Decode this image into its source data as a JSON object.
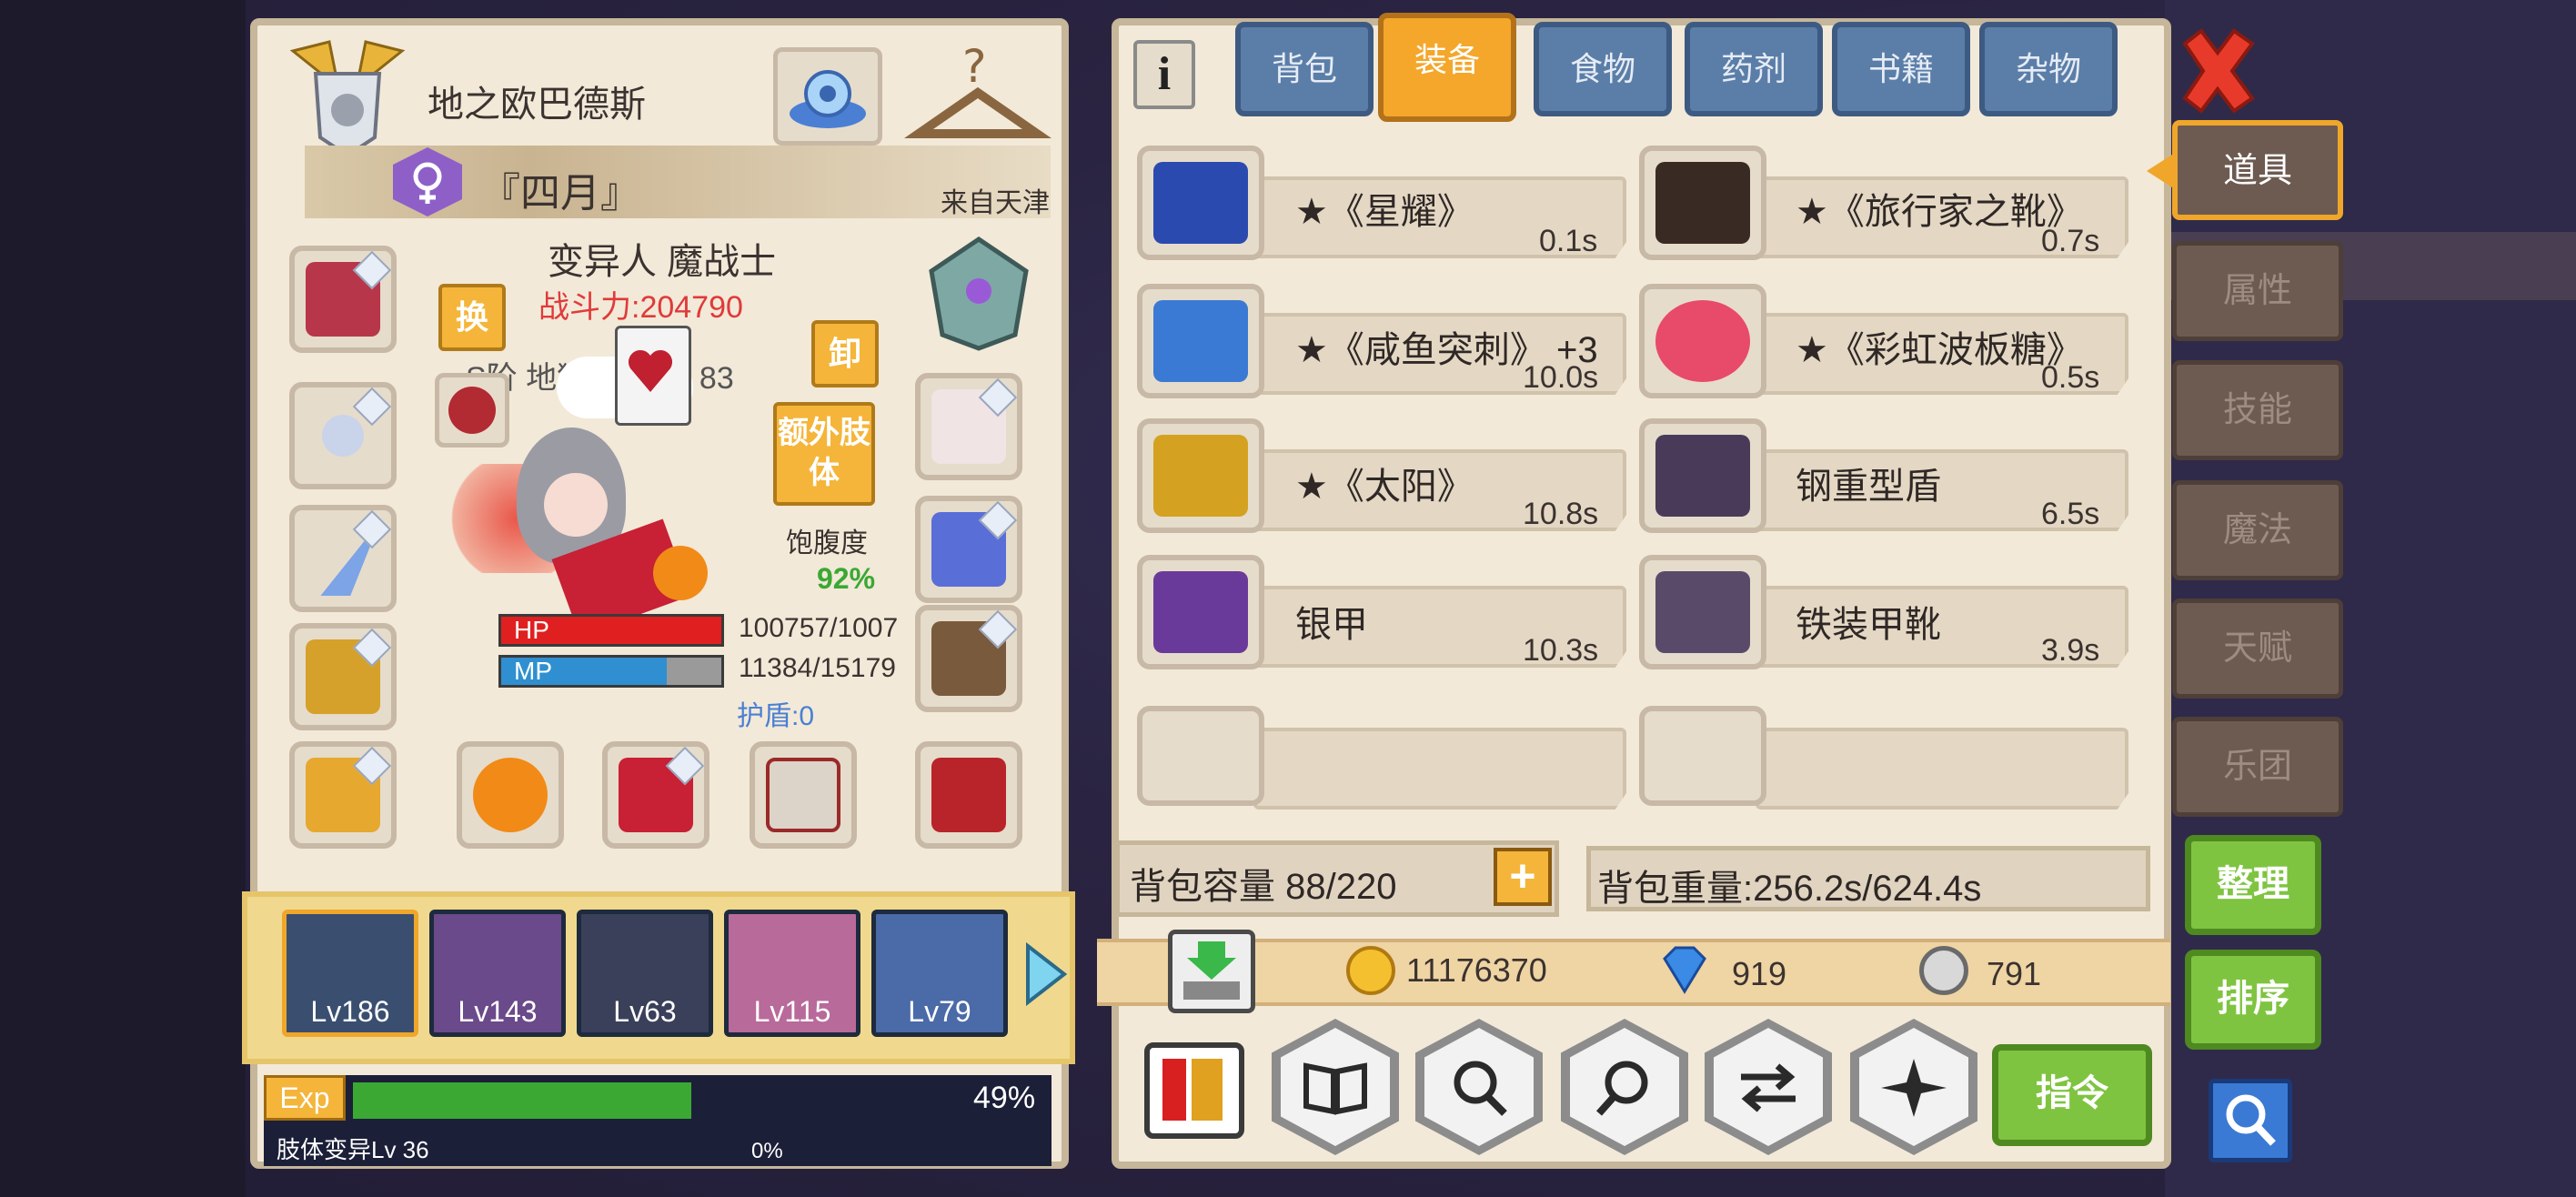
{
  "character": {
    "title": "地之欧巴德斯",
    "name": "『四月』",
    "origin": "来自天津",
    "class_line": "变异人 魔战士",
    "power": "战斗力:204790",
    "rank_line": "S阶 地狱使者 Lv 83",
    "swap_label": "换",
    "unequip_label": "卸",
    "extra_limb_label": "额外肢体",
    "satiety_label": "饱腹度",
    "satiety_value": "92%",
    "hp_label": "HP",
    "hp_value": "100757/1007",
    "hp_fraction": 1.0,
    "mp_label": "MP",
    "mp_value": "11384/15179",
    "mp_fraction": 0.75,
    "shield": "护盾:0"
  },
  "party": [
    {
      "level": "Lv186"
    },
    {
      "level": "Lv143"
    },
    {
      "level": "Lv63"
    },
    {
      "level": "Lv115"
    },
    {
      "level": "Lv79"
    }
  ],
  "exp": {
    "label": "Exp",
    "percent": "49%",
    "fraction": 0.49,
    "limb_label": "肢体变异Lv 36",
    "limb_percent": "0%"
  },
  "tabs": [
    "背包",
    "装备",
    "食物",
    "药剂",
    "书籍",
    "杂物"
  ],
  "active_tab": "装备",
  "items": [
    {
      "name": "★《星耀》",
      "weight": "0.1s"
    },
    {
      "name": "★《旅行家之靴》",
      "weight": "0.7s"
    },
    {
      "name": "★《咸鱼突刺》 +3",
      "weight": "10.0s"
    },
    {
      "name": "★《彩虹波板糖》",
      "weight": "0.5s"
    },
    {
      "name": "★《太阳》",
      "weight": "10.8s"
    },
    {
      "name": "钢重型盾",
      "weight": "6.5s"
    },
    {
      "name": "银甲",
      "weight": "10.3s"
    },
    {
      "name": "铁装甲靴",
      "weight": "3.9s"
    }
  ],
  "bag": {
    "capacity": "背包容量 88/220",
    "weight": "背包重量:256.2s/624.4s"
  },
  "currency": {
    "gold": "11176370",
    "diamond": "919",
    "silver": "791"
  },
  "side_tabs": [
    "道具",
    "属性",
    "技能",
    "魔法",
    "天赋",
    "乐团"
  ],
  "actions": {
    "organize": "整理",
    "sort": "排序",
    "command": "指令"
  },
  "info_label": "i",
  "colors": {
    "accent": "#f4a72b",
    "hp": "#e02020",
    "mp": "#2f8fd0",
    "exp": "#3aa833",
    "power": "#e03a3a"
  }
}
